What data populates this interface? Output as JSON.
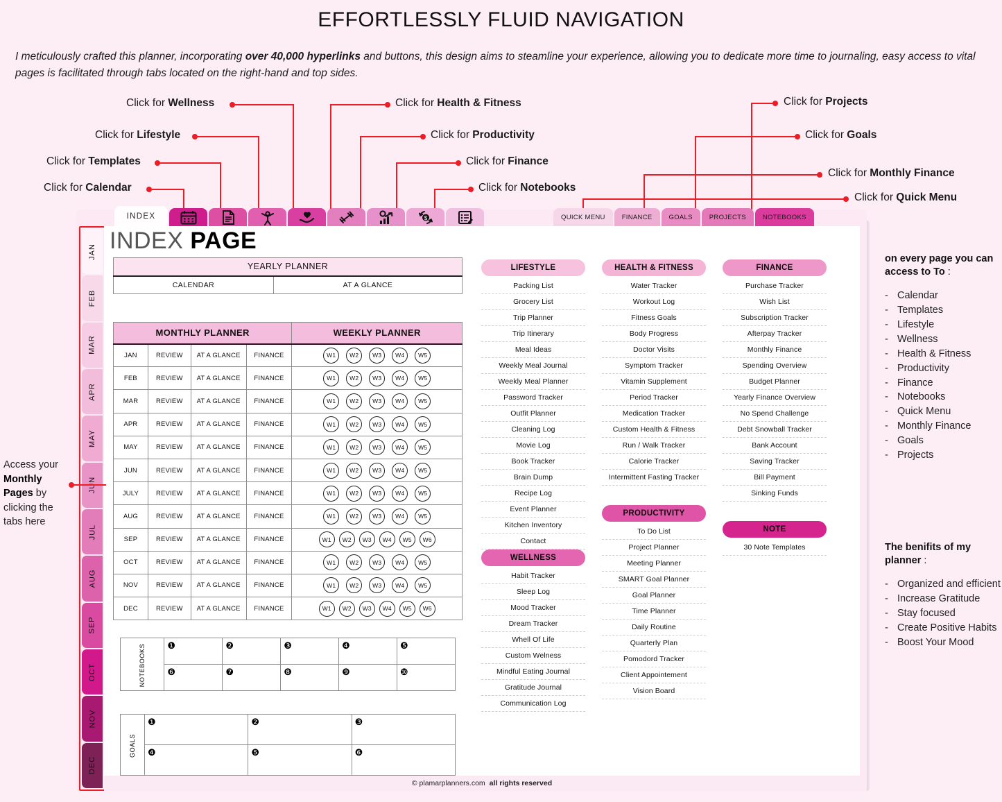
{
  "header": {
    "title": "EFFORTLESSLY FLUID NAVIGATION",
    "intro_part1": "I meticulously crafted this planner, incorporating ",
    "intro_bold": "over 40,000 hyperlinks",
    "intro_part2": " and buttons, this design aims to steamline your experience, allowing you to dedicate more time to journaling, easy access to vital pages is facilitated through tabs located on the right-hand and top sides."
  },
  "callouts": {
    "prefix": "Click for ",
    "left": [
      {
        "name": "wellness",
        "label": "Wellness"
      },
      {
        "name": "lifestyle",
        "label": "Lifestyle"
      },
      {
        "name": "templates",
        "label": "Templates"
      },
      {
        "name": "calendar",
        "label": "Calendar"
      }
    ],
    "middle": [
      {
        "name": "health-fitness",
        "label": "Health & Fitness"
      },
      {
        "name": "productivity",
        "label": "Productivity"
      },
      {
        "name": "finance",
        "label": "Finance"
      },
      {
        "name": "notebooks",
        "label": "Notebooks"
      }
    ],
    "right": [
      {
        "name": "projects",
        "label": "Projects"
      },
      {
        "name": "goals",
        "label": "Goals"
      },
      {
        "name": "monthly-finance",
        "label": "Monthly Finance"
      },
      {
        "name": "quick-menu",
        "label": "Quick Menu"
      }
    ]
  },
  "top_tabs": {
    "index_label": "INDEX",
    "icons": [
      {
        "name": "calendar-icon",
        "color": "#cf1d8e"
      },
      {
        "name": "document-icon",
        "color": "#dd4fa2"
      },
      {
        "name": "wellness-person-icon",
        "color": "#e05fae"
      },
      {
        "name": "heart-hand-icon",
        "color": "#d83fa0"
      },
      {
        "name": "dumbbell-icon",
        "color": "#e37ebf"
      },
      {
        "name": "productivity-chart-icon",
        "color": "#e691c9"
      },
      {
        "name": "money-cycle-icon",
        "color": "#eda8d5"
      },
      {
        "name": "notebook-list-icon",
        "color": "#f1bfe0"
      }
    ]
  },
  "right_tabs": [
    {
      "label": "QUICK MENU",
      "color": "#f6d7e9"
    },
    {
      "label": "FINANCE",
      "color": "#eeadd2"
    },
    {
      "label": "GOALS",
      "color": "#e88cc3"
    },
    {
      "label": "PROJECTS",
      "color": "#e479b9"
    },
    {
      "label": "NOTEBOOKS",
      "color": "#da3b9d"
    }
  ],
  "month_tabs": [
    {
      "label": "JAN",
      "color": "#fdf3f8"
    },
    {
      "label": "FEB",
      "color": "#f8d9ea"
    },
    {
      "label": "MAR",
      "color": "#f6cde4"
    },
    {
      "label": "APR",
      "color": "#f2bcdb"
    },
    {
      "label": "MAY",
      "color": "#efabd2"
    },
    {
      "label": "JUN",
      "color": "#e894c6"
    },
    {
      "label": "JUL",
      "color": "#e37dba"
    },
    {
      "label": "AUG",
      "color": "#dd62ac"
    },
    {
      "label": "SEP",
      "color": "#d84ba1"
    },
    {
      "label": "OCT",
      "color": "#d2198c"
    },
    {
      "label": "NOV",
      "color": "#a81a72"
    },
    {
      "label": "DEC",
      "color": "#7d2157"
    }
  ],
  "page": {
    "title_light": "INDEX ",
    "title_bold": "PAGE",
    "footer_copy": "© plamarplanners.com",
    "footer_rights": "all rights reserved"
  },
  "yearly_planner": {
    "header": "YEARLY PLANNER",
    "cells": [
      "CALENDAR",
      "AT A GLANCE"
    ]
  },
  "monthly_planner": {
    "header_left": "MONTHLY PLANNER",
    "header_right": "WEEKLY PLANNER",
    "col_review": "REVIEW",
    "col_at_a_glance": "AT A GLANCE",
    "col_finance": "FINANCE",
    "rows": [
      {
        "month": "JAN",
        "weeks": [
          "W1",
          "W2",
          "W3",
          "W4",
          "W5"
        ]
      },
      {
        "month": "FEB",
        "weeks": [
          "W1",
          "W2",
          "W3",
          "W4",
          "W5"
        ]
      },
      {
        "month": "MAR",
        "weeks": [
          "W1",
          "W2",
          "W3",
          "W4",
          "W5"
        ]
      },
      {
        "month": "APR",
        "weeks": [
          "W1",
          "W2",
          "W3",
          "W4",
          "W5"
        ]
      },
      {
        "month": "MAY",
        "weeks": [
          "W1",
          "W2",
          "W3",
          "W4",
          "W5"
        ]
      },
      {
        "month": "JUN",
        "weeks": [
          "W1",
          "W2",
          "W3",
          "W4",
          "W5"
        ]
      },
      {
        "month": "JULY",
        "weeks": [
          "W1",
          "W2",
          "W3",
          "W4",
          "W5"
        ]
      },
      {
        "month": "AUG",
        "weeks": [
          "W1",
          "W2",
          "W3",
          "W4",
          "W5"
        ]
      },
      {
        "month": "SEP",
        "weeks": [
          "W1",
          "W2",
          "W3",
          "W4",
          "W5",
          "W6"
        ]
      },
      {
        "month": "OCT",
        "weeks": [
          "W1",
          "W2",
          "W3",
          "W4",
          "W5"
        ]
      },
      {
        "month": "NOV",
        "weeks": [
          "W1",
          "W2",
          "W3",
          "W4",
          "W5"
        ]
      },
      {
        "month": "DEC",
        "weeks": [
          "W1",
          "W2",
          "W3",
          "W4",
          "W5",
          "W6"
        ]
      }
    ]
  },
  "notebooks_grid": {
    "side_label": "NOTEBOOKS",
    "numbers": [
      "❶",
      "❷",
      "❸",
      "❹",
      "❺",
      "❻",
      "❼",
      "❽",
      "❾",
      "❿"
    ]
  },
  "goals_grid": {
    "side_label": "GOALS",
    "numbers": [
      "❶",
      "❷",
      "❸",
      "❹",
      "❺",
      "❻"
    ]
  },
  "columns": [
    {
      "name": "lifestyle",
      "sections": [
        {
          "pill": "LIFESTYLE",
          "pill_color": "#f6c2de",
          "items": [
            "Packing List",
            "Grocery List",
            "Trip Planner",
            "Trip Itinerary",
            "Meal Ideas",
            "Weekly Meal Journal",
            "Weekly Meal Planner",
            "Password Tracker",
            "Outfit Planner",
            "Cleaning Log",
            "Movie Log",
            "Book Tracker",
            "Brain Dump",
            "Recipe Log",
            "Event Planner",
            "Kitchen Inventory",
            "Contact"
          ]
        },
        {
          "pill": "WELLNESS",
          "pill_color": "#e466b0",
          "gap_before": false,
          "items": [
            "Habit Tracker",
            "Sleep Log",
            "Mood Tracker",
            "Dream Tracker",
            "Whell Of Life",
            "Custom Welness",
            "Mindful Eating Journal",
            "Gratitude Journal",
            "Communication Log"
          ]
        }
      ]
    },
    {
      "name": "health-fitness",
      "sections": [
        {
          "pill": "HEALTH & FITNESS",
          "pill_color": "#f4b4d6",
          "items": [
            "Water Tracker",
            "Workout Log",
            "Fitness Goals",
            "Body Progress",
            "Doctor Visits",
            "Symptom Tracker",
            "Vitamin Supplement",
            "Period Tracker",
            "Medication Tracker",
            "Custom Health & Fitness",
            "Run / Walk Tracker",
            "Calorie Tracker",
            "Intermittent Fasting Tracker"
          ]
        },
        {
          "pill": "PRODUCTIVITY",
          "pill_color": "#e054a8",
          "gap_before": true,
          "items": [
            "To Do List",
            "Project Planner",
            "Meeting Planner",
            "SMART Goal Planner",
            "Goal Planner",
            "Time Planner",
            "Daily Routine",
            "Quarterly Plan",
            "Pomodord Tracker",
            "Client Appointement",
            "Vision Board"
          ]
        }
      ]
    },
    {
      "name": "finance",
      "sections": [
        {
          "pill": "FINANCE",
          "pill_color": "#ee98c9",
          "items": [
            "Purchase Tracker",
            "Wish List",
            "Subscription Tracker",
            "Afterpay Tracker",
            "Monthly Finance",
            "Spending Overview",
            "Budget Planner",
            "Yearly Finance Overview",
            "No Spend Challenge",
            "Debt Snowball Tracker",
            "Bank Account",
            "Saving Tracker",
            "Bill Payment",
            "Sinking Funds"
          ]
        },
        {
          "pill": "NOTE",
          "pill_color": "#d6248f",
          "gap_before": true,
          "items": [
            "30 Note Templates"
          ]
        }
      ]
    }
  ],
  "info_panel": {
    "heading_bold": "on every page you can access to To",
    "heading_tail": " :",
    "items": [
      "Calendar",
      "Templates",
      "Lifestyle",
      "Wellness",
      "Health & Fitness",
      "Productivity",
      "Finance",
      "Notebooks",
      "Quick Menu",
      "Monthly Finance",
      "Goals",
      "Projects"
    ]
  },
  "benefits_panel": {
    "heading_bold": "The benifits of my planner",
    "heading_tail": " :",
    "items": [
      "Organized and efficient",
      "Increase Gratitude",
      "Stay focused",
      "Create Positive Habits",
      "Boost Your Mood"
    ]
  },
  "left_note": {
    "part1": "Access your ",
    "bold1": "Monthly Pages",
    "part2": " by clicking the tabs here"
  },
  "colors": {
    "accent_red": "#ee1c25",
    "bg": "#fdeef6",
    "brand_pink": "#d6248f"
  }
}
